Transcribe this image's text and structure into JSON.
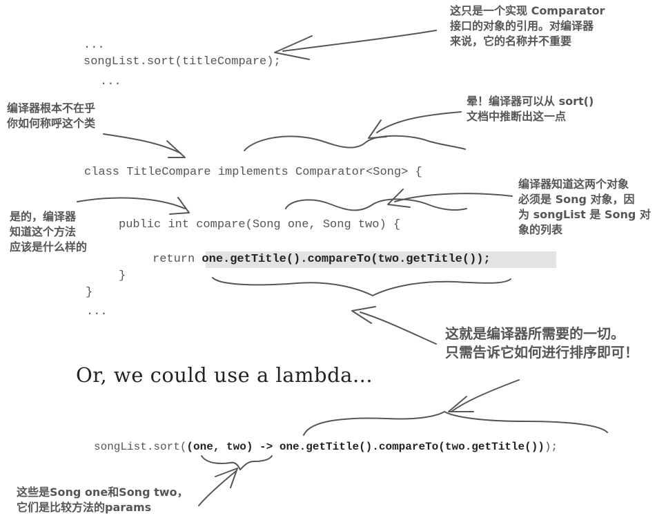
{
  "code_top": {
    "dots1": "...",
    "sort_call_prefix": "songList.sort(",
    "sort_call_arg": "titleCompare",
    "sort_call_suffix": ");",
    "dots2": "...",
    "class_decl": "class TitleCompare implements Comparator<Song> {",
    "method_decl": "public int compare(Song one, Song two) {",
    "return_kw": "return",
    "return_expr": "one.getTitle().compareTo(two.getTitle());",
    "close_method": "}",
    "close_class": "}",
    "dots3": "..."
  },
  "notes": {
    "comparator_ref": "这只是一个实现 Comparator\n接口的对象的引用。对编译器\n来说，它的名称并不重要",
    "class_name": "编译器根本不在乎\n你如何称呼这个类",
    "sort_docs": "晕！编译器可以从 sort()\n文档中推断出这一点",
    "objects_song": "编译器知道这两个对象\n必须是 Song 对象，因\n为 songList 是 Song 对\n象的列表",
    "method_shape": "是的，编译器\n知道这个方法\n应该是什么样的",
    "all_needed": "这就是编译器所需要的一切。\n只需告诉它如何进行排序即可！",
    "lambda_params": "这些是Song one和Song two，\n它们是比较方法的params"
  },
  "lambda": {
    "heading": "Or, we could use a lambda...",
    "prefix": "songList.sort(",
    "params": "(one, two)",
    "arrow": " -> ",
    "body": "one.getTitle().compareTo(two.getTitle())",
    "suffix": ");"
  },
  "colors": {
    "ink": "#555555",
    "code_bold": "#222222",
    "highlight": "#e3e3e3"
  }
}
